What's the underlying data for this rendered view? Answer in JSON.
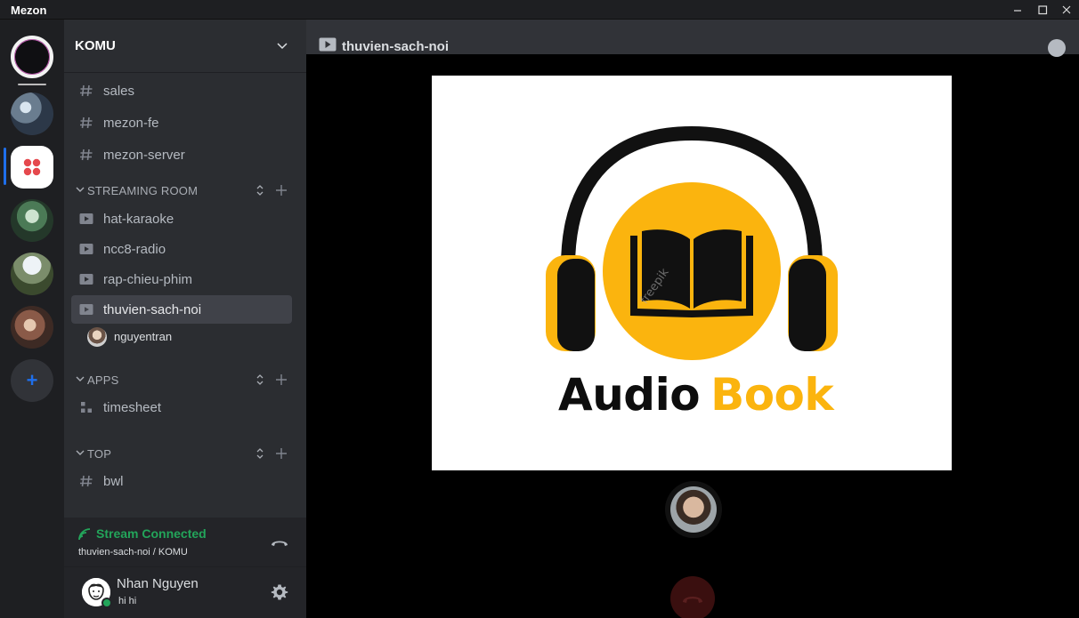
{
  "window": {
    "title": "Mezon",
    "controls": [
      "minimize",
      "maximize",
      "close"
    ]
  },
  "rail": {
    "items": [
      {
        "name": "home-avatar"
      },
      {
        "name": "server-1"
      },
      {
        "name": "server-komu"
      },
      {
        "name": "server-3"
      },
      {
        "name": "server-4"
      },
      {
        "name": "server-5"
      }
    ],
    "add_symbol": "+"
  },
  "server": {
    "name": "KOMU"
  },
  "channels_top": [
    {
      "label": "sales",
      "icon": "hash-icon"
    },
    {
      "label": "mezon-fe",
      "icon": "hash-icon"
    },
    {
      "label": "mezon-server",
      "icon": "hash-icon"
    }
  ],
  "categories": {
    "streaming": {
      "label": "STREAMING ROOM",
      "channels": [
        {
          "label": "hat-karaoke"
        },
        {
          "label": "ncc8-radio"
        },
        {
          "label": "rap-chieu-phim"
        },
        {
          "label": "thuvien-sach-noi",
          "active": true
        }
      ],
      "participant": "nguyentran"
    },
    "apps": {
      "label": "APPS",
      "channels": [
        {
          "label": "timesheet"
        }
      ]
    },
    "top": {
      "label": "TOP",
      "channels": [
        {
          "label": "bwl"
        }
      ]
    }
  },
  "voice": {
    "status": "Stream Connected",
    "location": "thuvien-sach-noi / KOMU"
  },
  "user": {
    "name": "Nhan Nguyen",
    "status": "hi hi"
  },
  "main": {
    "channel_title": "thuvien-sach-noi",
    "stream": {
      "word1": "Audio",
      "word2": "Book",
      "watermark": "freepik"
    }
  },
  "colors": {
    "accent": "#1f6feb",
    "connected": "#23a55a",
    "book_yellow": "#fbb40e",
    "sidebar_bg": "#2b2d31",
    "rail_bg": "#1e1f22"
  }
}
